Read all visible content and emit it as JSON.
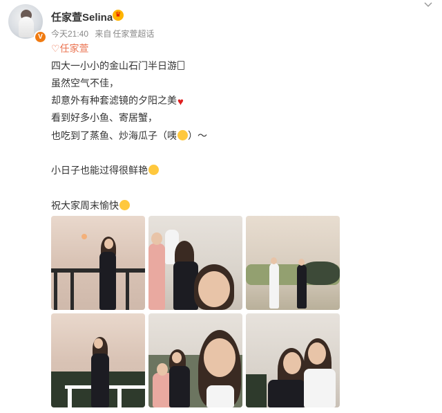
{
  "user": {
    "name": "任家萱Selina",
    "verified_badge": "V"
  },
  "meta": {
    "time": "今天21:40",
    "source_prefix": "来自",
    "source": "任家萱超话"
  },
  "topic_tag": "♡任家萱",
  "post_lines": [
    "四大一小小的金山石门半日游",
    "虽然空气不佳，",
    "却意外有种套滤镜的夕阳之美",
    "看到好多小鱼、寄居蟹，",
    "也吃到了蒸鱼、炒海瓜子（咦",
    "）～",
    "小日子也能过得很鲜艳",
    "祝大家周末愉快"
  ],
  "icons": [
    "crown-icon",
    "chevron-down-icon",
    "heart-icon",
    "emoji-icon"
  ],
  "colors": {
    "accent": "#eb7350",
    "badge": "#f07b12",
    "heart": "#e02020"
  },
  "photos": [
    {
      "label": "photo-1"
    },
    {
      "label": "photo-2"
    },
    {
      "label": "photo-3"
    },
    {
      "label": "photo-4"
    },
    {
      "label": "photo-5"
    },
    {
      "label": "photo-6"
    }
  ]
}
